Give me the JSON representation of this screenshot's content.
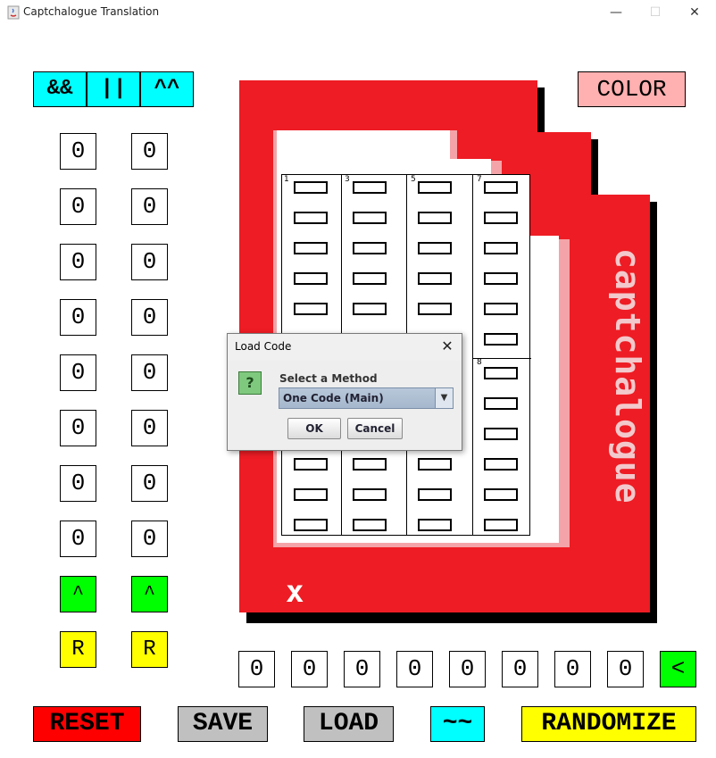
{
  "window": {
    "title": "Captchalogue Translation",
    "minimize": "—",
    "maximize": "☐",
    "close": "✕"
  },
  "operators": [
    "&&",
    "||",
    "^^"
  ],
  "color_button": "COLOR",
  "left_column": [
    "0",
    "0",
    "0",
    "0",
    "0",
    "0",
    "0",
    "0"
  ],
  "right_column": [
    "0",
    "0",
    "0",
    "0",
    "0",
    "0",
    "0",
    "0"
  ],
  "up_label": "^",
  "reset_label": "R",
  "bottom_digits": [
    "0",
    "0",
    "0",
    "0",
    "0",
    "0",
    "0",
    "0"
  ],
  "enter_label": "<",
  "actions": {
    "reset": "RESET",
    "save": "SAVE",
    "load": "LOAD",
    "tilde": "~~",
    "randomize": "RANDOMIZE"
  },
  "card": {
    "brand_text": "captchalogue",
    "mark": "x",
    "color": "#ee1c24"
  },
  "grid": {
    "column_numbers": [
      "1",
      "3",
      "5",
      "7",
      "8"
    ]
  },
  "dialog": {
    "title": "Load Code",
    "close": "✕",
    "icon": "?",
    "label": "Select a Method",
    "selected": "One Code (Main)",
    "ok": "OK",
    "cancel": "Cancel"
  },
  "colors": {
    "cyan": "#00ffff",
    "green": "#00ff00",
    "yellow": "#ffff00",
    "red": "#ff0000",
    "gray": "#c0c0c0",
    "pink": "#ffb0b0"
  }
}
